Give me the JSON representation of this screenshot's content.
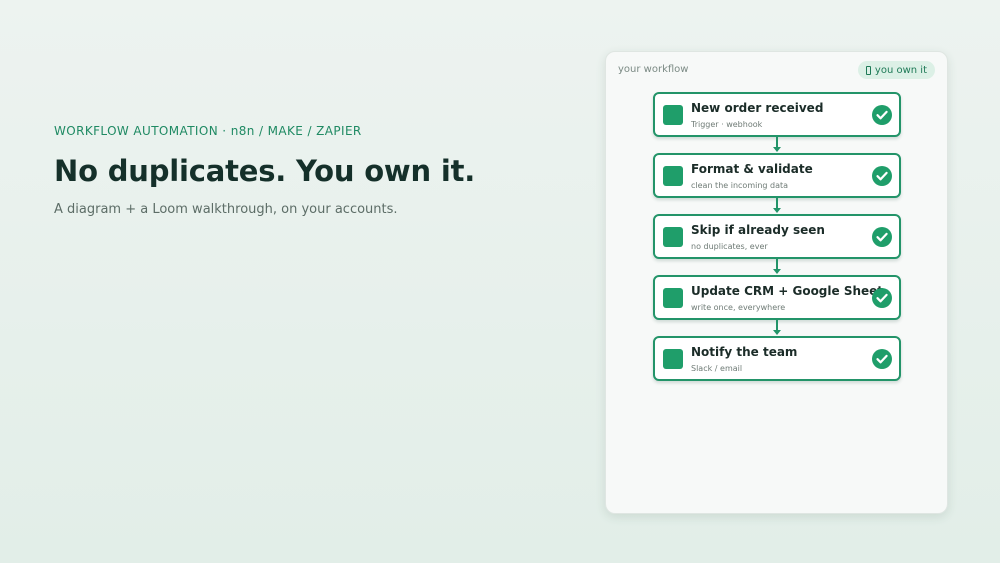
{
  "hero": {
    "eyebrow": "WORKFLOW AUTOMATION · n8n / MAKE / ZAPIER",
    "headline": "No duplicates. You own it.",
    "subline": "A diagram + a Loom walkthrough, on your accounts."
  },
  "panel": {
    "title": "your workflow",
    "badge": "you own it",
    "badge_icon": "lock-icon"
  },
  "steps": [
    {
      "title": "New order received",
      "subtitle": "Trigger · webhook",
      "status": "done"
    },
    {
      "title": "Format & validate",
      "subtitle": "clean the incoming data",
      "status": "done"
    },
    {
      "title": "Skip if already seen",
      "subtitle": "no duplicates, ever",
      "status": "done"
    },
    {
      "title": "Update CRM + Google Sheet",
      "subtitle": "write once, everywhere",
      "status": "done"
    },
    {
      "title": "Notify the team",
      "subtitle": "Slack / email",
      "status": "done"
    }
  ],
  "colors": {
    "accent": "#1f9e6a",
    "border": "#239469",
    "headline": "#15302a",
    "badge_bg": "#dcf0e6"
  }
}
